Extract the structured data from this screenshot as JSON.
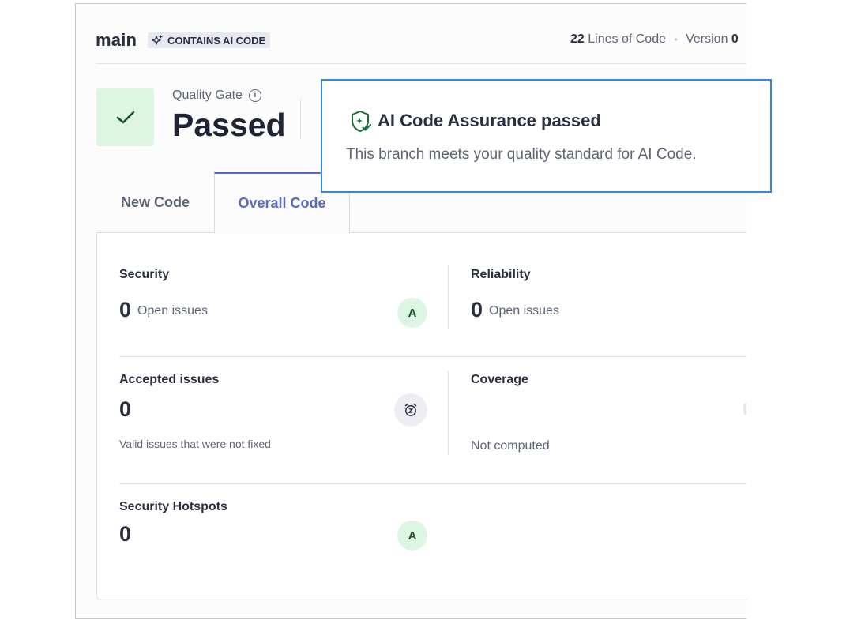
{
  "header": {
    "branch_name": "main",
    "ai_badge": "CONTAINS AI CODE",
    "lines_count": "22",
    "lines_label": "Lines of Code",
    "separator": "•",
    "version_label": "Version",
    "version_value": "0"
  },
  "quality_gate": {
    "label": "Quality Gate",
    "info_icon": "i",
    "status": "Passed",
    "status_color": "#dcf6e3"
  },
  "popover": {
    "title": "AI Code Assurance passed",
    "message": "This branch meets your quality standard for AI Code."
  },
  "tabs": [
    {
      "label": "New Code",
      "active": false
    },
    {
      "label": "Overall Code",
      "active": true
    }
  ],
  "cards": {
    "security": {
      "title": "Security",
      "value": "0",
      "unit": "Open issues",
      "grade": "A"
    },
    "reliability": {
      "title": "Reliability",
      "value": "0",
      "unit": "Open issues"
    },
    "accepted": {
      "title": "Accepted issues",
      "value": "0",
      "description": "Valid issues that were not fixed",
      "icon": "snooze-icon"
    },
    "coverage": {
      "title": "Coverage",
      "status": "Not computed"
    },
    "hotspots": {
      "title": "Security Hotspots",
      "value": "0",
      "grade": "A"
    }
  },
  "colors": {
    "accent": "#5a6abf",
    "popover_border": "#3a86d6",
    "grade_bg": "#dcf6e3",
    "grade_text": "#1d4d30"
  }
}
